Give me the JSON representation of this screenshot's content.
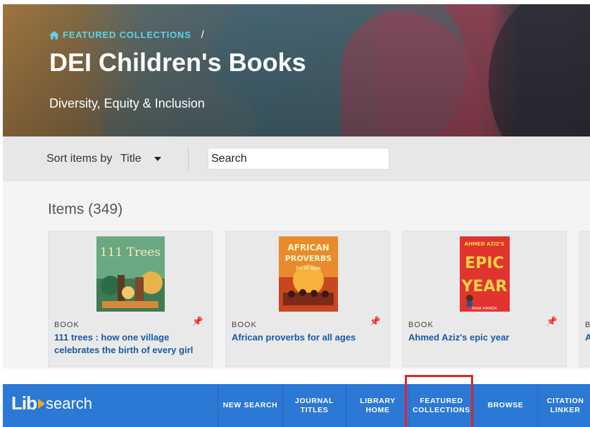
{
  "hero": {
    "breadcrumb": "FEATURED COLLECTIONS",
    "separator": "/",
    "title": "DEI Children's Books",
    "subtitle": "Diversity, Equity & Inclusion"
  },
  "toolbar": {
    "sort_label": "Sort items by",
    "sort_value": "Title",
    "search_value": "Search"
  },
  "items": {
    "heading": "Items (349)",
    "cards": [
      {
        "type": "BOOK",
        "title": "111 trees : how one village celebrates the birth of every girl",
        "cover_text": "111 Trees"
      },
      {
        "type": "BOOK",
        "title": "African proverbs for all ages",
        "cover_text": "AFRICAN PROVERBS",
        "cover_sub": "For All Ages"
      },
      {
        "type": "BOOK",
        "title": "Ahmed Aziz's epic year",
        "cover_text": "AHMED AZIZ'S",
        "cover_big": "EPIC YEAR",
        "cover_author": "NINA HAMZA"
      },
      {
        "type": "B",
        "title": "A"
      }
    ]
  },
  "nav": {
    "logo_lib": "Lib",
    "logo_search": "search",
    "items": [
      {
        "line1": "NEW SEARCH",
        "line2": ""
      },
      {
        "line1": "JOURNAL",
        "line2": "TITLES"
      },
      {
        "line1": "LIBRARY",
        "line2": "HOME"
      },
      {
        "line1": "FEATURED",
        "line2": "COLLECTIONS"
      },
      {
        "line1": "BROWSE",
        "line2": ""
      },
      {
        "line1": "CITATION",
        "line2": "LINKER"
      }
    ]
  },
  "colors": {
    "nav_bg": "#2b78d5",
    "link": "#1a5aa0",
    "breadcrumb": "#5fd3e8",
    "highlight": "#e0232b"
  }
}
